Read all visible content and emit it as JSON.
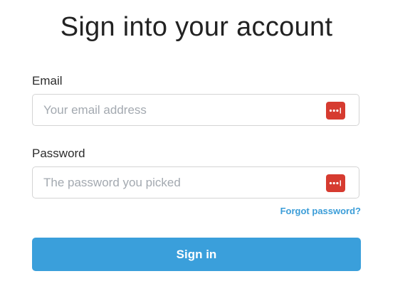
{
  "page": {
    "title": "Sign into your account"
  },
  "form": {
    "email": {
      "label": "Email",
      "placeholder": "Your email address",
      "value": ""
    },
    "password": {
      "label": "Password",
      "placeholder": "The password you picked",
      "value": ""
    },
    "forgot_password_link": "Forgot password?",
    "submit_label": "Sign in"
  },
  "icons": {
    "password_manager": "password-manager-icon"
  },
  "colors": {
    "primary": "#3a9fdb",
    "link": "#3b9dd8",
    "password_manager_badge": "#d63b30",
    "input_border": "#d4d4d4",
    "placeholder": "#a3a9b0"
  }
}
